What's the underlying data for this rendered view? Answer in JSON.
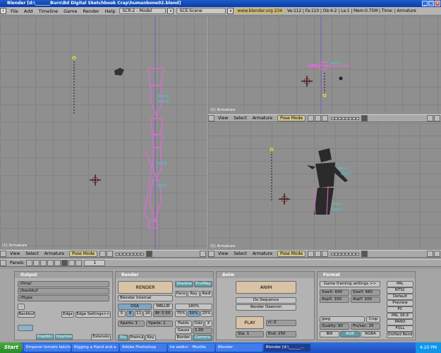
{
  "window": {
    "title": "Blender [d:\\_______Burn\\Bd Digital Sketchbook Crap\\humanbone02.blend]"
  },
  "menubar": {
    "items": [
      "File",
      "Add",
      "Timeline",
      "Game",
      "Render",
      "Help"
    ],
    "screen": "SCR:2 - Model",
    "scene": "SCE:Scene",
    "url": "www.blender.org 234",
    "stats": "Ve:112 | Fa:110 | Ob:4-2 | La:1 | Mem:0.75M | Time: | Armature"
  },
  "viewports": {
    "left_label": "(1) Armature",
    "top_right_label": "(1) Armature",
    "bottom_right_label": "(1) Armature",
    "bone_labels": {
      "left": [
        "Arm.R",
        "Arm.R",
        "Leg.R",
        "Leg.R"
      ],
      "persp": [
        "Arm.1",
        "Arm.2",
        "Leg.1",
        "Leg.2"
      ],
      "top": [
        "Arm.1"
      ]
    }
  },
  "viewheader": {
    "view": "View",
    "select": "Select",
    "armature": "Armature",
    "mode": "Pose Mode"
  },
  "buttonsheader": {
    "panels": "Panels",
    "frame": "1"
  },
  "output": {
    "title": "Output",
    "paths": [
      "//tmp/",
      "//backbuf",
      "//ftype"
    ],
    "backbuf": "Backbuf",
    "edge": "Edge",
    "edge_settings": "Edge Settings>>",
    "disp_win": "DispWin",
    "disp_view": "DispView",
    "extensions": "Extensio"
  },
  "render": {
    "title": "Render",
    "render_btn": "RENDER",
    "engine": "Blender Internal",
    "shadow": "Shadow",
    "envmap": "EnvMap",
    "pano": "Pano",
    "ray": "Ray",
    "radio": "Radi",
    "osa": "OSA",
    "mblur": "MBLUR",
    "osa_values": [
      "5",
      "8",
      "11",
      "16"
    ],
    "bf": "Bf: 0.50",
    "size_label": "180%",
    "sizes": [
      "75%",
      "50%",
      "25%"
    ],
    "xparts": "Xparts: 1",
    "yparts": "Yparts: 1",
    "fields": "Fields",
    "odd": "Odd",
    "x": "X",
    "gauss": "Gauss",
    "gauss_val": "1.00",
    "sky": "Sky",
    "premul": "Premul",
    "key": "Key",
    "border": "Border",
    "gamma": "Gamma"
  },
  "anim": {
    "title": "Anim",
    "anim_btn": "ANIM",
    "do_sequence": "Do Sequence",
    "render_daemon": "Render Daemon",
    "play": "PLAY",
    "rt": "rt: 0",
    "sta": "Sta: 1",
    "end": "End: 250"
  },
  "format": {
    "title": "Format",
    "game_framing": "Game framing settings >>",
    "sizex": "SizeX: 640",
    "sizey": "SizeY: 480",
    "aspx": "AspX: 100",
    "aspy": "AspY: 100",
    "codec": "Jpeg",
    "crop": "Crop",
    "quality": "Quality: 90",
    "fps": "Frs/sec: 25",
    "bw": "BW",
    "rgb": "RGB",
    "rgba": "RGBA",
    "presets": [
      "PAL",
      "NTSC",
      "Default",
      "Preview",
      "PC",
      "PAL 16:9",
      "PANO",
      "FULL"
    ],
    "unified": "Unified Rend"
  },
  "taskbar": {
    "start": "Start",
    "tasks": [
      "Emperor tomato ketchup",
      "Rigging a Hand and a ...",
      "Adobe Photoshop",
      "he walks! - Mozilla",
      "Blender",
      "Blender [d:\\______..."
    ],
    "clock": "4:20 PM"
  },
  "colors": {
    "bone": "#e06ad8",
    "bone_label": "#38d6e6",
    "viewport": "#8f8f8f",
    "mode": "#d2c68a"
  }
}
